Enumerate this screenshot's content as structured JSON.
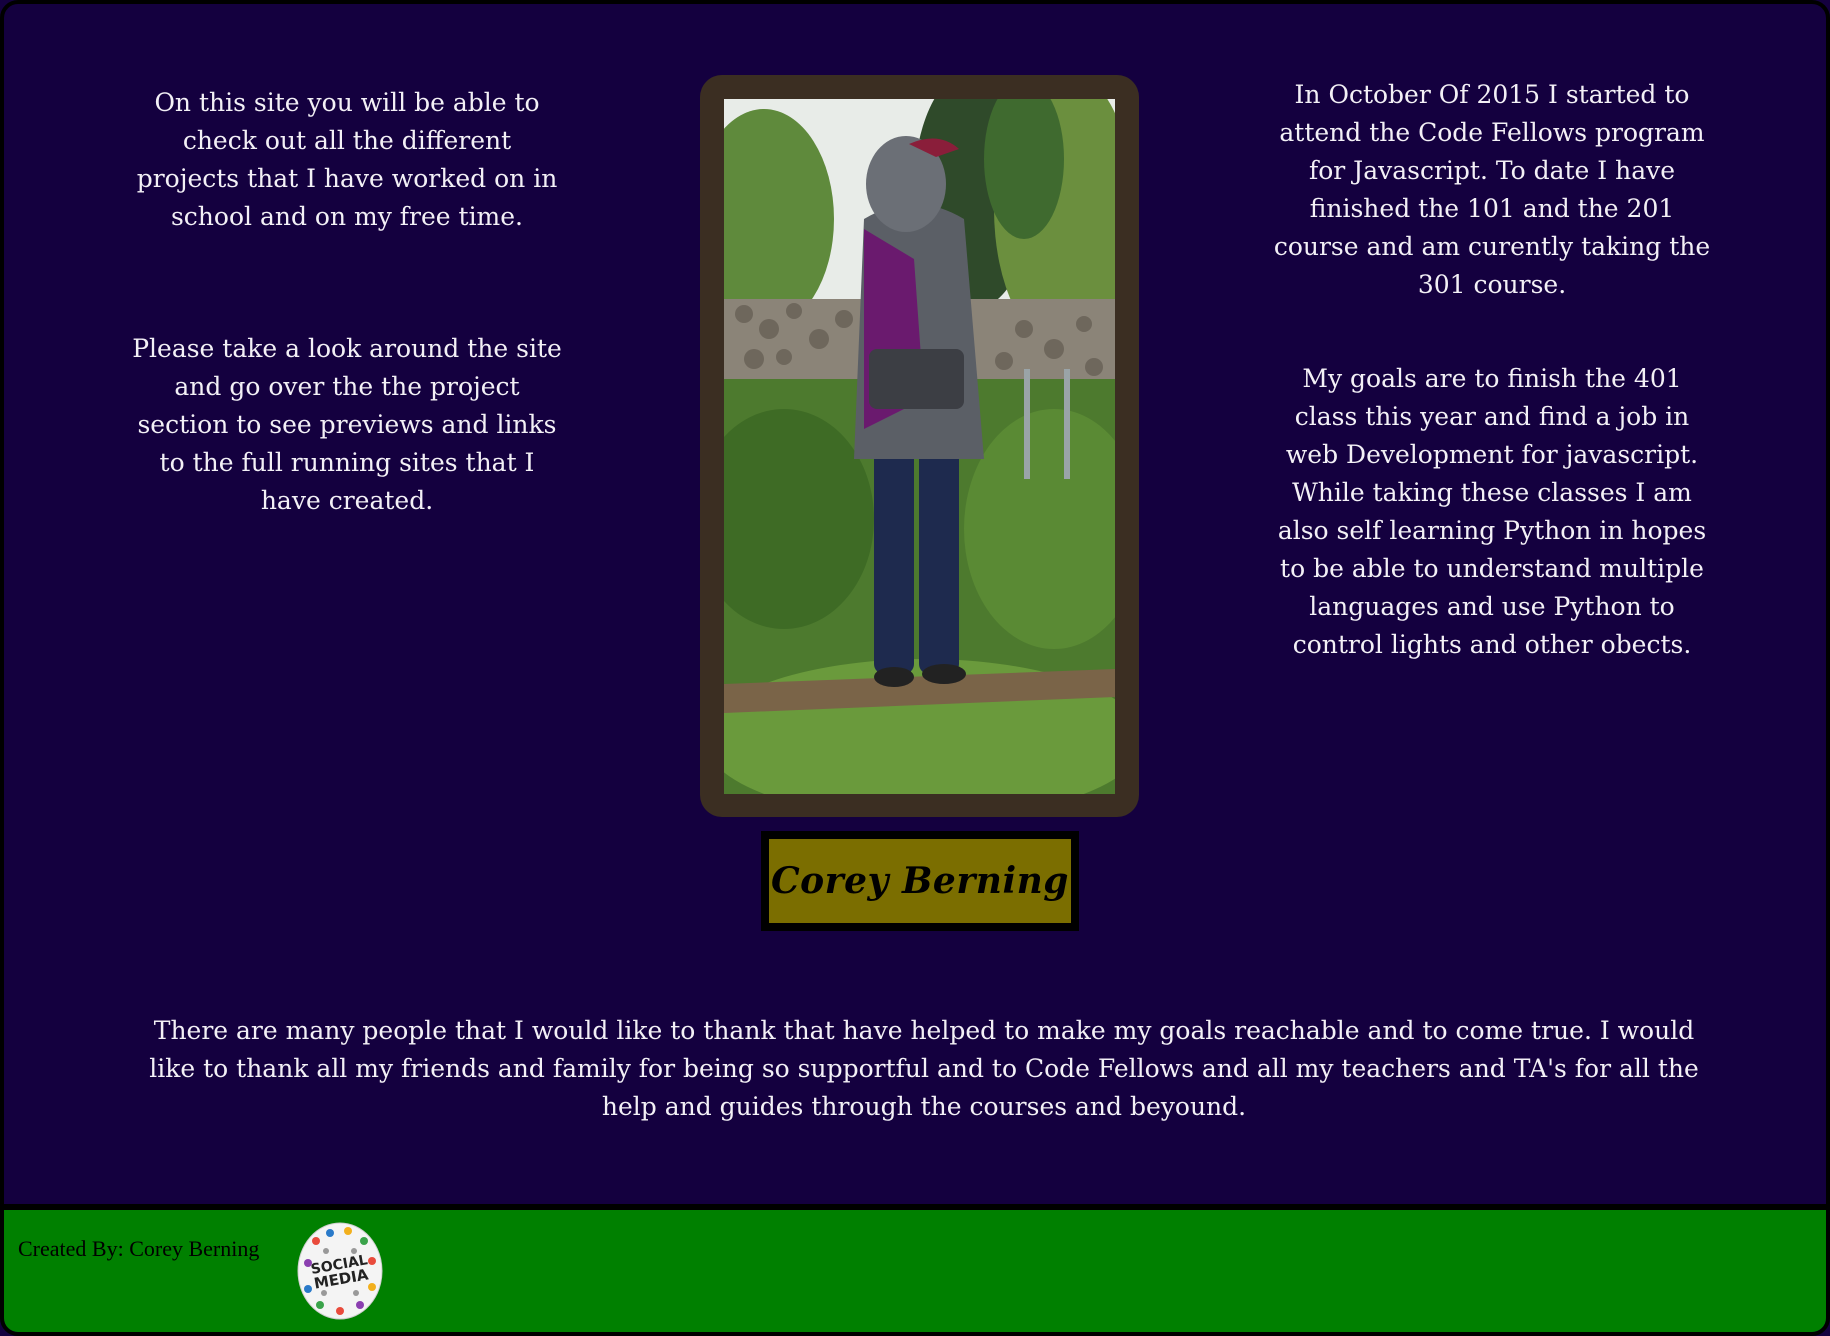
{
  "intro": {
    "paragraph_1": "On this site you will be able to check out all the different projects that I have worked on in school and on my free time.",
    "paragraph_2": "Please take a look around the site and go over the the project section to see previews and links to the full running sites that I have created."
  },
  "about": {
    "paragraph_1": "In October Of 2015 I started to attend the Code Fellows program for Javascript. To date I have finished the 101 and the 201 course and am curently taking the 301 course.",
    "paragraph_2": "My goals are to finish the 401 class this year and find a job in web Development for javascript. While taking these classes I am also self learning Python in hopes to be able to understand multiple languages and use Python to control lights and other obects."
  },
  "profile": {
    "name": "Corey Berning",
    "photo_icon": "profile-photo"
  },
  "thanks": {
    "text": "There are many people that I would like to thank that have helped to make my goals reachable and to come true. I would like to thank all my friends and family for being so supportful and to Code Fellows and all my teachers and TA's for all the help and guides through the courses and beyound."
  },
  "footer": {
    "credit": "Created By: Corey Berning",
    "social_icon": "social-media-icon",
    "badge_lines": [
      "SOCIAL",
      "MEDIA"
    ]
  },
  "colors": {
    "background": "#14003f",
    "footer": "#008000",
    "name_box": "#7b6e00",
    "photo_frame": "#3b2e22",
    "text": "#f3f0f6"
  }
}
